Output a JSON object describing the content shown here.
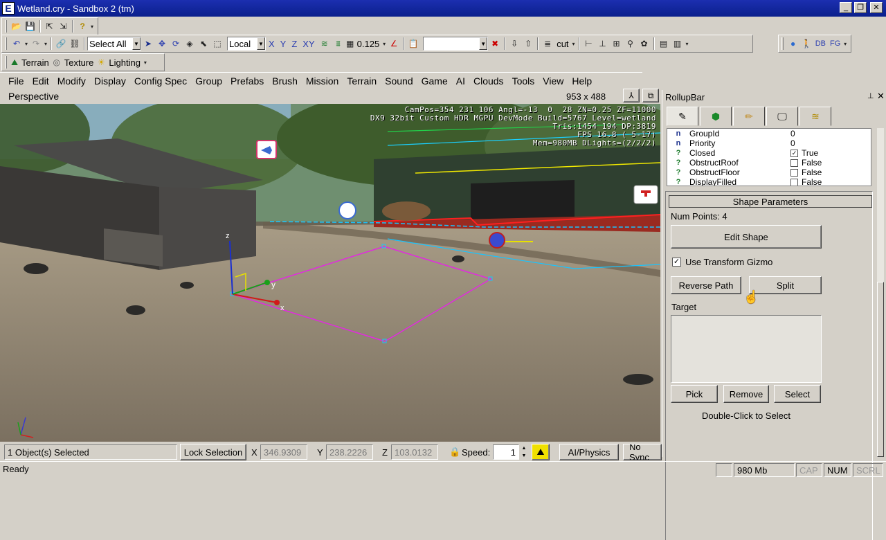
{
  "window": {
    "title": "Wetland.cry - Sandbox 2 (tm)",
    "app_icon": "E",
    "minimize": "_",
    "restore": "❐",
    "close": "✕"
  },
  "toolbar1": {
    "icons": [
      "open-icon",
      "save-icon",
      "export-icon",
      "import-icon",
      "help-icon"
    ]
  },
  "toolbar2": {
    "select_combo": "Select All",
    "coord_combo": "Local",
    "axes": [
      "X",
      "Y",
      "Z",
      "XY"
    ],
    "grid_value": "0.125",
    "layer_combo": "cut"
  },
  "toolbar3": {
    "labels": [
      "DB",
      "FG"
    ]
  },
  "toolbar4": {
    "terrain": "Terrain",
    "texture": "Texture",
    "lighting": "Lighting"
  },
  "menu": [
    "File",
    "Edit",
    "Modify",
    "Display",
    "Config Spec",
    "Group",
    "Prefabs",
    "Brush",
    "Mission",
    "Terrain",
    "Sound",
    "Game",
    "AI",
    "Clouds",
    "Tools",
    "View",
    "Help"
  ],
  "viewport": {
    "name": "Perspective",
    "resolution": "953 x 488",
    "hud_lines": [
      "CamPos=354 231 106 Angl=-13  0  28 ZN=0.25 ZF=11000",
      "DX9 32bit Custom HDR MGPU DevMode Build=5767 Level=wetland",
      "Tris:1454 194 DP:3819",
      "FPS 16.8 ( 5-17)",
      "Mem=980MB DLights=(2/2/2)"
    ],
    "gizmo_labels": {
      "x": "x",
      "y": "y",
      "z": "z"
    }
  },
  "rollup": {
    "title": "RollupBar",
    "pin": "📌",
    "close": "✕",
    "tabs": [
      "create-tab",
      "objects-tab",
      "edit-tab",
      "display-tab",
      "layers-tab"
    ],
    "properties": [
      {
        "type": "n",
        "name": "GroupId",
        "value": "0",
        "check": null
      },
      {
        "type": "n",
        "name": "Priority",
        "value": "0",
        "check": null
      },
      {
        "type": "?",
        "name": "Closed",
        "value": "True",
        "check": true
      },
      {
        "type": "?",
        "name": "ObstructRoof",
        "value": "False",
        "check": false
      },
      {
        "type": "?",
        "name": "ObstructFloor",
        "value": "False",
        "check": false
      },
      {
        "type": "?",
        "name": "DisplayFilled",
        "value": "False",
        "check": false
      }
    ],
    "section_title": "Shape Parameters",
    "num_points": "Num Points: 4",
    "edit_shape": "Edit Shape",
    "use_gizmo": "Use Transform Gizmo",
    "reverse_path": "Reverse Path",
    "split": "Split",
    "target_label": "Target",
    "pick": "Pick",
    "remove": "Remove",
    "select": "Select",
    "double_click": "Double-Click to Select"
  },
  "info": {
    "selected": "1 Object(s) Selected",
    "lock_selection": "Lock Selection",
    "x_label": "X",
    "x": "346.9309",
    "y_label": "Y",
    "y": "238.2226",
    "z_label": "Z",
    "z": "103.0132",
    "speed_label": "Speed:",
    "speed": "1",
    "ai_physics": "AI/Physics",
    "no_sync": "No Sync"
  },
  "status": {
    "ready": "Ready",
    "memory": "980 Mb",
    "cap": "CAP",
    "num": "NUM",
    "scrl": "SCRL"
  }
}
